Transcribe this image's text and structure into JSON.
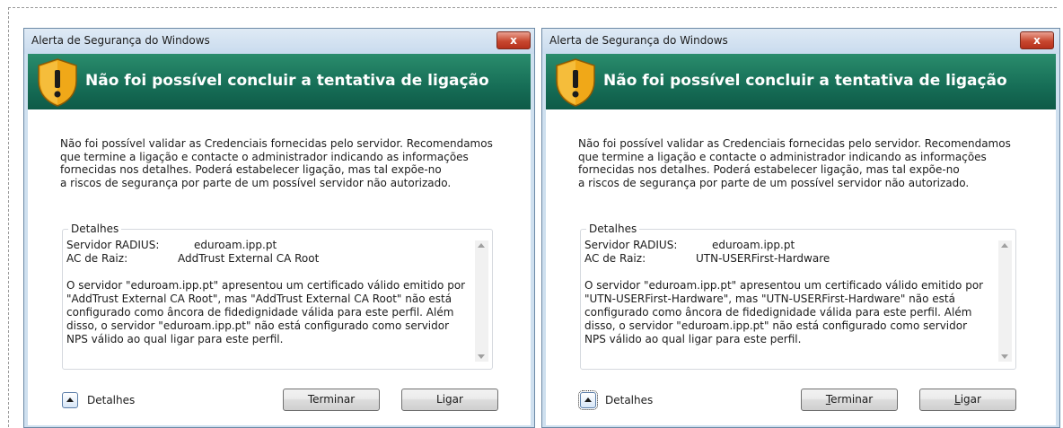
{
  "dialogs": [
    {
      "title": "Alerta de Segurança do Windows",
      "close_label": "x",
      "headline": "Não foi possível concluir a tentativa de ligação",
      "message": "Não foi possível validar as Credenciais fornecidas pelo servidor. Recomendamos\nque termine a ligação e contacte o administrador indicando as informações\nfornecidas nos detalhes. Poderá estabelecer ligação, mas tal expõe-no\na riscos de segurança por parte de um possível servidor não autorizado.",
      "details": {
        "legend": "Detalhes",
        "server_label": "Servidor RADIUS:",
        "server_value": "eduroam.ipp.pt",
        "root_label": "AC de Raiz:",
        "root_value": "AddTrust External CA Root",
        "text": "O servidor \"eduroam.ipp.pt\" apresentou um certificado válido emitido por\n\"AddTrust External CA Root\", mas \"AddTrust External CA Root\" não está\nconfigurado como âncora de fidedignidade válida para este perfil. Além\ndisso, o servidor \"eduroam.ipp.pt\" não está configurado como servidor\nNPS válido ao qual ligar para este perfil."
      },
      "toggle_label": "Detalhes",
      "terminate_label": "Terminar",
      "connect_label": "Ligar"
    },
    {
      "title": "Alerta de Segurança do Windows",
      "close_label": "x",
      "headline": "Não foi possível concluir a tentativa de ligação",
      "message": "Não foi possível validar as Credenciais fornecidas pelo servidor. Recomendamos\nque termine a ligação e contacte o administrador indicando as informações\nfornecidas nos detalhes. Poderá estabelecer ligação, mas tal expõe-no\na riscos de segurança por parte de um possível servidor não autorizado.",
      "details": {
        "legend": "Detalhes",
        "server_label": "Servidor RADIUS:",
        "server_value": "eduroam.ipp.pt",
        "root_label": "AC de Raiz:",
        "root_value": "UTN-USERFirst-Hardware",
        "text": "O servidor \"eduroam.ipp.pt\" apresentou um certificado válido emitido por\n\"UTN-USERFirst-Hardware\", mas \"UTN-USERFirst-Hardware\" não está\nconfigurado como âncora de fidedignidade válida para este perfil. Além\ndisso, o servidor \"eduroam.ipp.pt\" não está configurado como servidor\nNPS válido ao qual ligar para este perfil."
      },
      "toggle_label": "Detalhes",
      "terminate_label": "Terminar",
      "terminate_mnemonic": "T",
      "terminate_rest": "erminar",
      "connect_label": "Ligar",
      "connect_mnemonic": "L",
      "connect_rest": "igar"
    }
  ],
  "colors": {
    "banner": "#166d56",
    "shield": "#f0a818",
    "close_button": "#c8482f"
  },
  "icons": {
    "banner": "warning-shield-icon",
    "close": "close-icon",
    "toggle": "chevron-up-icon"
  }
}
